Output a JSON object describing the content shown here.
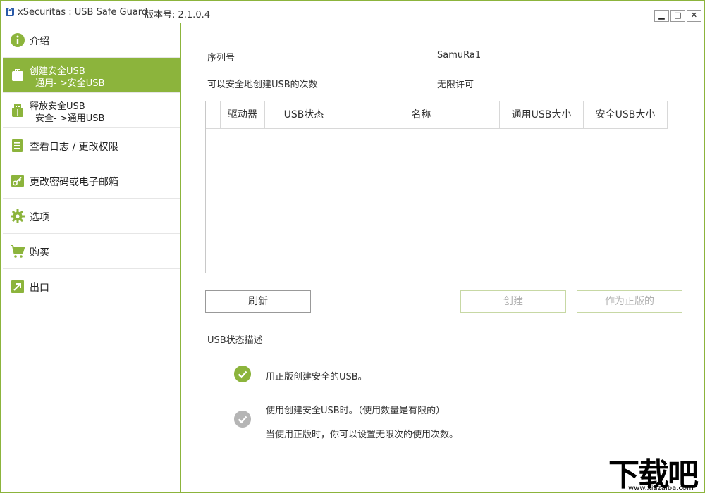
{
  "titlebar": {
    "title": "xSecuritas : USB Safe Guard",
    "version": "版本号: 2.1.0.4",
    "min": "▁",
    "max": "□",
    "close": "✕"
  },
  "sidebar": {
    "items": [
      {
        "label": "介绍",
        "icon": "info-icon"
      },
      {
        "label": "创建安全USB",
        "sub": "通用- >安全USB",
        "icon": "usb-drive-icon"
      },
      {
        "label": "释放安全USB",
        "sub": "安全- >通用USB",
        "icon": "usb-plug-icon"
      },
      {
        "label": "查看日志 / 更改权限",
        "icon": "document-icon"
      },
      {
        "label": "更改密码或电子邮箱",
        "icon": "key-icon"
      },
      {
        "label": "选项",
        "icon": "gear-icon"
      },
      {
        "label": "购买",
        "icon": "cart-icon"
      },
      {
        "label": "出口",
        "icon": "exit-icon"
      }
    ]
  },
  "main": {
    "serial_label": "序列号",
    "serial_value": "SamuRa1",
    "count_label": "可以安全地创建USB的次数",
    "count_value": "无限许可",
    "table": {
      "columns": [
        "驱动器",
        "USB状态",
        "名称",
        "通用USB大小",
        "安全USB大小"
      ],
      "rows": []
    },
    "buttons": {
      "refresh": "刷新",
      "create": "创建",
      "genuine": "作为正版的"
    },
    "desc_title": "USB状态描述",
    "desc1": "用正版创建安全的USB。",
    "desc2a": "使用创建安全USB时。（使用数量是有限的）",
    "desc2b": "当使用正版时，你可以设置无限次的使用次数。"
  },
  "watermark": {
    "text": "下载吧",
    "url": "www.xiazaiba.com"
  },
  "colors": {
    "accent": "#8cb43c",
    "inactive_check": "#b5b5b5"
  }
}
